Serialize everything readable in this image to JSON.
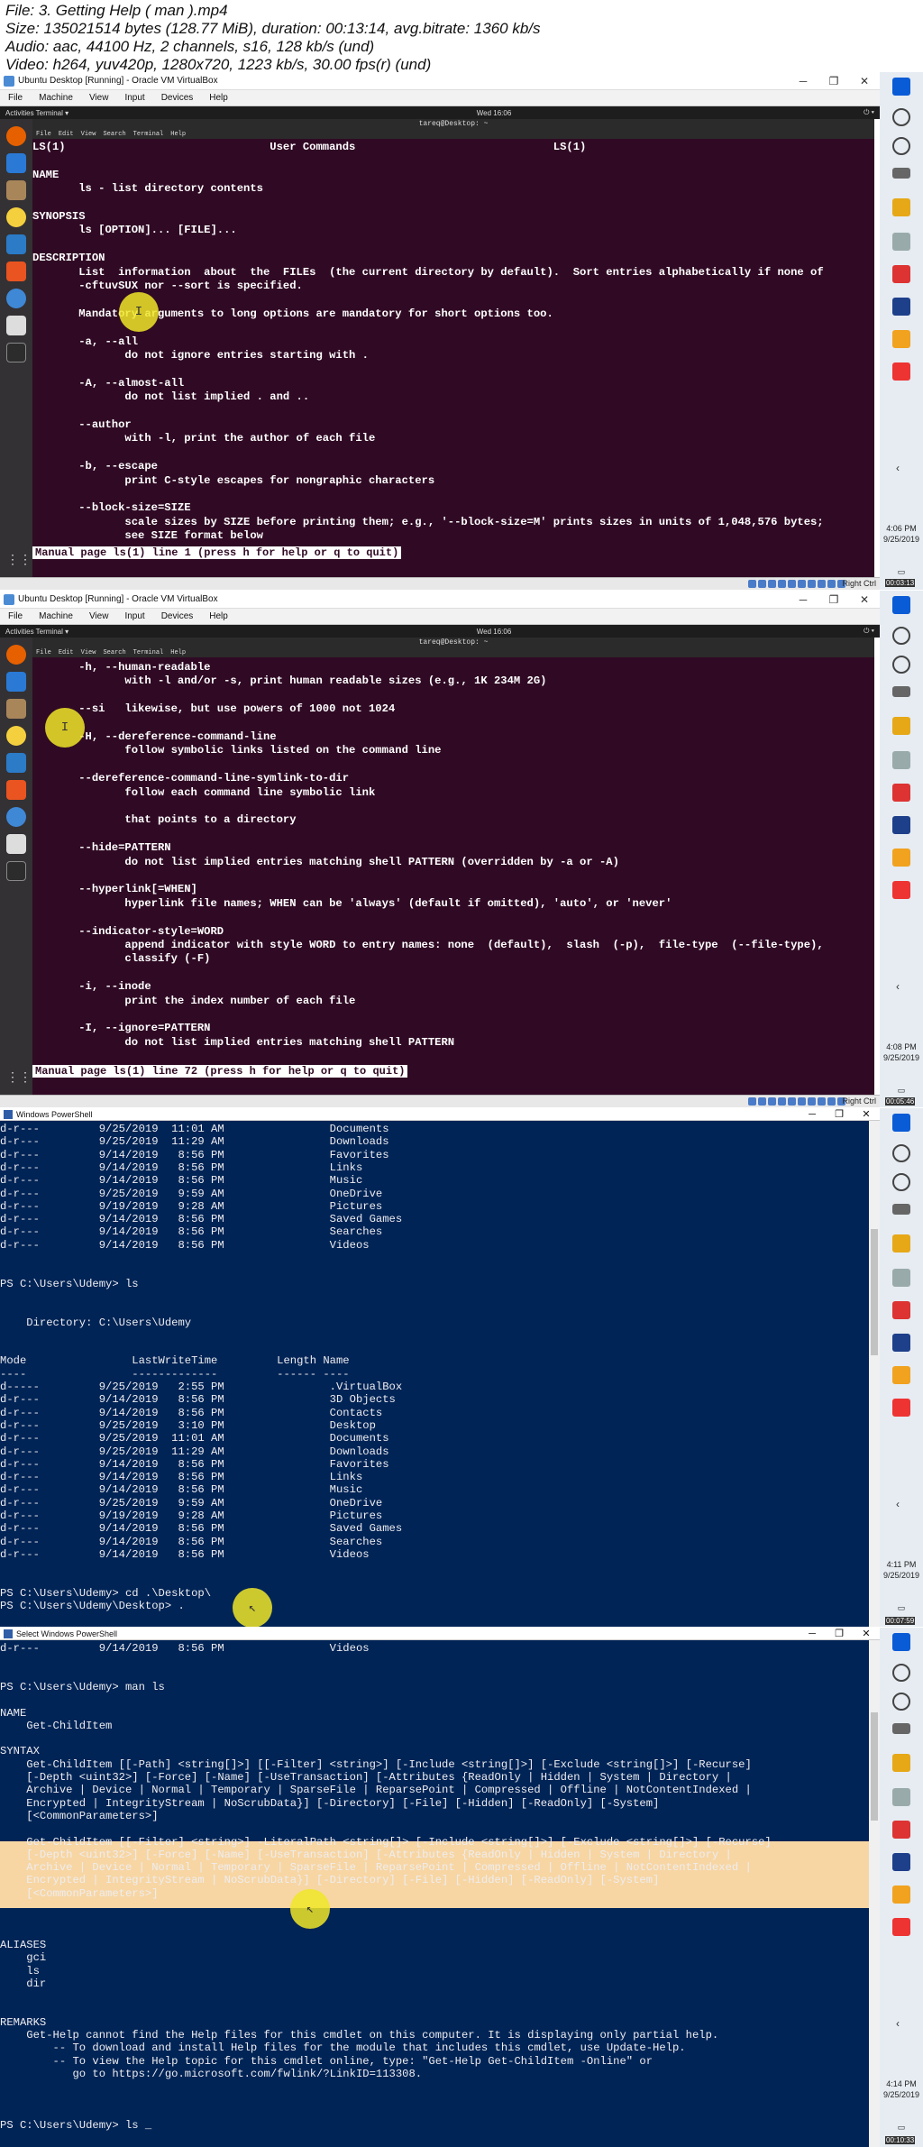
{
  "info": {
    "line1": "File: 3. Getting Help ( man ).mp4",
    "line2": "Size: 135021514 bytes (128.77 MiB), duration: 00:13:14, avg.bitrate: 1360 kb/s",
    "line3": "Audio: aac, 44100 Hz, 2 channels, s16, 128 kb/s (und)",
    "line4": "Video: h264, yuv420p, 1280x720, 1223 kb/s, 30.00 fps(r) (und)"
  },
  "vbox": {
    "title": "Ubuntu Desktop [Running] - Oracle VM VirtualBox",
    "menu": [
      "File",
      "Machine",
      "View",
      "Input",
      "Devices",
      "Help"
    ],
    "activities": "Activities",
    "terminal_menu": "Terminal ▾",
    "clock": "Wed 16:06",
    "term_title": "tareq@Desktop: ~",
    "term_menu": [
      "File",
      "Edit",
      "View",
      "Search",
      "Terminal",
      "Help"
    ],
    "right_ctrl": "Right Ctrl"
  },
  "frame1": {
    "lines": [
      "LS(1)                               User Commands                              LS(1)",
      "",
      "NAME",
      "       ls - list directory contents",
      "",
      "SYNOPSIS",
      "       ls [OPTION]... [FILE]...",
      "",
      "DESCRIPTION",
      "       List  information  about  the  FILEs  (the current directory by default).  Sort entries alphabetically if none of",
      "       -cftuvSUX nor --sort is specified.",
      "",
      "       Mandatory arguments to long options are mandatory for short options too.",
      "",
      "       -a, --all",
      "              do not ignore entries starting with .",
      "",
      "       -A, --almost-all",
      "              do not list implied . and ..",
      "",
      "       --author",
      "              with -l, print the author of each file",
      "",
      "       -b, --escape",
      "              print C-style escapes for nongraphic characters",
      "",
      "       --block-size=SIZE",
      "              scale sizes by SIZE before printing them; e.g., '--block-size=M' prints sizes in units of 1,048,576 bytes;",
      "              see SIZE format below"
    ],
    "status": "Manual page ls(1) line 1 (press h for help or q to quit)"
  },
  "frame2": {
    "lines": [
      "       -h, --human-readable",
      "              with -l and/or -s, print human readable sizes (e.g., 1K 234M 2G)",
      "",
      "       --si   likewise, but use powers of 1000 not 1024",
      "",
      "       -H, --dereference-command-line",
      "              follow symbolic links listed on the command line",
      "",
      "       --dereference-command-line-symlink-to-dir",
      "              follow each command line symbolic link",
      "",
      "              that points to a directory",
      "",
      "       --hide=PATTERN",
      "              do not list implied entries matching shell PATTERN (overridden by -a or -A)",
      "",
      "       --hyperlink[=WHEN]",
      "              hyperlink file names; WHEN can be 'always' (default if omitted), 'auto', or 'never'",
      "",
      "       --indicator-style=WORD",
      "              append indicator with style WORD to entry names: none  (default),  slash  (-p),  file-type  (--file-type),",
      "              classify (-F)",
      "",
      "       -i, --inode",
      "              print the index number of each file",
      "",
      "       -I, --ignore=PATTERN",
      "              do not list implied entries matching shell PATTERN"
    ],
    "status": "Manual page ls(1) line 72 (press h for help or q to quit)"
  },
  "frame3": {
    "title": "Windows PowerShell",
    "lines": [
      "d-r---         9/25/2019  11:01 AM                Documents",
      "d-r---         9/25/2019  11:29 AM                Downloads",
      "d-r---         9/14/2019   8:56 PM                Favorites",
      "d-r---         9/14/2019   8:56 PM                Links",
      "d-r---         9/14/2019   8:56 PM                Music",
      "d-r---         9/25/2019   9:59 AM                OneDrive",
      "d-r---         9/19/2019   9:28 AM                Pictures",
      "d-r---         9/14/2019   8:56 PM                Saved Games",
      "d-r---         9/14/2019   8:56 PM                Searches",
      "d-r---         9/14/2019   8:56 PM                Videos",
      "",
      "",
      "PS C:\\Users\\Udemy> ls",
      "",
      "",
      "    Directory: C:\\Users\\Udemy",
      "",
      "",
      "Mode                LastWriteTime         Length Name",
      "----                -------------         ------ ----",
      "d-----         9/25/2019   2:55 PM                .VirtualBox",
      "d-r---         9/14/2019   8:56 PM                3D Objects",
      "d-r---         9/14/2019   8:56 PM                Contacts",
      "d-r---         9/25/2019   3:10 PM                Desktop",
      "d-r---         9/25/2019  11:01 AM                Documents",
      "d-r---         9/25/2019  11:29 AM                Downloads",
      "d-r---         9/14/2019   8:56 PM                Favorites",
      "d-r---         9/14/2019   8:56 PM                Links",
      "d-r---         9/14/2019   8:56 PM                Music",
      "d-r---         9/25/2019   9:59 AM                OneDrive",
      "d-r---         9/19/2019   9:28 AM                Pictures",
      "d-r---         9/14/2019   8:56 PM                Saved Games",
      "d-r---         9/14/2019   8:56 PM                Searches",
      "d-r---         9/14/2019   8:56 PM                Videos",
      "",
      "",
      "PS C:\\Users\\Udemy> cd .\\Desktop\\",
      "PS C:\\Users\\Udemy\\Desktop> ."
    ],
    "clock_time": "4:11 PM",
    "clock_date": "9/25/2019"
  },
  "frame4": {
    "title": "Select Windows PowerShell",
    "lines": [
      "d-r---         9/14/2019   8:56 PM                Videos",
      "",
      "",
      "PS C:\\Users\\Udemy> man ls",
      "",
      "NAME",
      "    Get-ChildItem",
      "",
      "SYNTAX",
      "    Get-ChildItem [[-Path] <string[]>] [[-Filter] <string>] [-Include <string[]>] [-Exclude <string[]>] [-Recurse]",
      "    [-Depth <uint32>] [-Force] [-Name] [-UseTransaction] [-Attributes {ReadOnly | Hidden | System | Directory |",
      "    Archive | Device | Normal | Temporary | SparseFile | ReparsePoint | Compressed | Offline | NotContentIndexed |",
      "    Encrypted | IntegrityStream | NoScrubData}] [-Directory] [-File] [-Hidden] [-ReadOnly] [-System]",
      "    [<CommonParameters>]",
      "",
      "    Get-ChildItem [[-Filter] <string>] -LiteralPath <string[]> [-Include <string[]>] [-Exclude <string[]>] [-Recurse]",
      "    [-Depth <uint32>] [-Force] [-Name] [-UseTransaction] [-Attributes {ReadOnly | Hidden | System | Directory |",
      "    Archive | Device | Normal | Temporary | SparseFile | ReparsePoint | Compressed | Offline | NotContentIndexed |",
      "    Encrypted | IntegrityStream | NoScrubData}] [-Directory] [-File] [-Hidden] [-ReadOnly] [-System]",
      "    [<CommonParameters>]",
      "",
      "",
      "",
      "ALIASES",
      "    gci",
      "    ls",
      "    dir",
      "",
      "",
      "REMARKS",
      "    Get-Help cannot find the Help files for this cmdlet on this computer. It is displaying only partial help.",
      "        -- To download and install Help files for the module that includes this cmdlet, use Update-Help.",
      "        -- To view the Help topic for this cmdlet online, type: \"Get-Help Get-ChildItem -Online\" or",
      "           go to https://go.microsoft.com/fwlink/?LinkID=113308.",
      "",
      "",
      "",
      "PS C:\\Users\\Udemy> ls _"
    ],
    "clock_time": "4:14 PM",
    "clock_date": "9/25/2019"
  },
  "taskbar": {
    "clock1_time": "4:06 PM",
    "clock1_date": "9/25/2019",
    "clock2_time": "4:08 PM",
    "clock2_date": "9/25/2019"
  },
  "timestamps": [
    "00:03:13",
    "00:05:46",
    "00:07:59",
    "00:10:33"
  ]
}
